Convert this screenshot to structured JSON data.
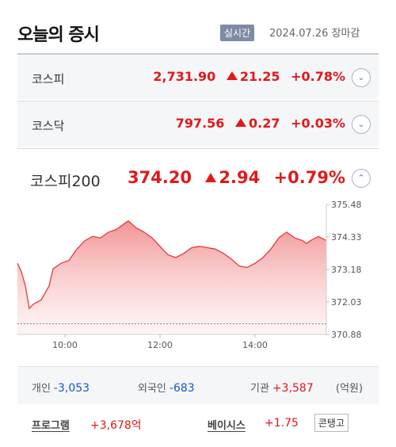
{
  "header": {
    "title": "오늘의 증시",
    "realtime_badge": "실시간",
    "timestamp": "2024.07.26 장마감"
  },
  "indices": [
    {
      "name": "코스피",
      "value": "2,731.90",
      "change": "21.25",
      "rate": "+0.78%",
      "direction": "up",
      "expand_icon": "chevron-down-icon"
    },
    {
      "name": "코스닥",
      "value": "797.56",
      "change": "0.27",
      "rate": "+0.03%",
      "direction": "up",
      "expand_icon": "chevron-down-icon"
    }
  ],
  "kospi200": {
    "name": "코스피200",
    "value": "374.20",
    "change": "2.94",
    "rate": "+0.79%",
    "direction": "up",
    "collapse_icon": "chevron-up-icon"
  },
  "chart_data": {
    "type": "area",
    "title": "",
    "xlabel": "",
    "ylabel": "",
    "x_ticks": [
      "10:00",
      "12:00",
      "14:00"
    ],
    "y_ticks": [
      "375.48",
      "374.33",
      "373.18",
      "372.03",
      "370.88"
    ],
    "ylim": [
      370.88,
      375.48
    ],
    "x_range": [
      "09:00",
      "15:30"
    ],
    "baseline": 371.26,
    "colors": {
      "line": "#e8393a",
      "fill": "#fbd5d5",
      "baseline": "#888888"
    },
    "series": [
      {
        "points": [
          [
            "09:00",
            373.4
          ],
          [
            "09:05",
            373.1
          ],
          [
            "09:10",
            372.6
          ],
          [
            "09:15",
            371.8
          ],
          [
            "09:20",
            371.95
          ],
          [
            "09:30",
            372.1
          ],
          [
            "09:40",
            372.6
          ],
          [
            "09:45",
            373.2
          ],
          [
            "09:55",
            373.4
          ],
          [
            "10:05",
            373.5
          ],
          [
            "10:15",
            373.9
          ],
          [
            "10:25",
            374.2
          ],
          [
            "10:35",
            374.35
          ],
          [
            "10:45",
            374.3
          ],
          [
            "10:55",
            374.5
          ],
          [
            "11:05",
            374.6
          ],
          [
            "11:15",
            374.8
          ],
          [
            "11:20",
            374.9
          ],
          [
            "11:30",
            374.65
          ],
          [
            "11:40",
            374.5
          ],
          [
            "11:50",
            374.3
          ],
          [
            "12:00",
            374.0
          ],
          [
            "12:10",
            373.7
          ],
          [
            "12:20",
            373.6
          ],
          [
            "12:30",
            373.75
          ],
          [
            "12:40",
            373.95
          ],
          [
            "12:50",
            374.0
          ],
          [
            "13:00",
            373.95
          ],
          [
            "13:10",
            373.9
          ],
          [
            "13:20",
            373.75
          ],
          [
            "13:30",
            373.55
          ],
          [
            "13:40",
            373.3
          ],
          [
            "13:50",
            373.25
          ],
          [
            "14:00",
            373.4
          ],
          [
            "14:10",
            373.6
          ],
          [
            "14:20",
            373.9
          ],
          [
            "14:30",
            374.3
          ],
          [
            "14:40",
            374.5
          ],
          [
            "14:50",
            374.3
          ],
          [
            "15:00",
            374.2
          ],
          [
            "15:05",
            374.1
          ],
          [
            "15:10",
            374.2
          ],
          [
            "15:20",
            374.35
          ],
          [
            "15:30",
            374.2
          ]
        ]
      }
    ]
  },
  "investor_flow": {
    "individual_label": "개인",
    "individual_value": "-3,053",
    "foreign_label": "외국인",
    "foreign_value": "-683",
    "institution_label": "기관",
    "institution_value": "+3,587",
    "unit": "(억원)"
  },
  "bottom": {
    "program_label": "프로그램",
    "program_value": "+3,678억",
    "basis_label": "베이시스",
    "basis_value": "+1.75",
    "contango_button": "콘탱고"
  }
}
